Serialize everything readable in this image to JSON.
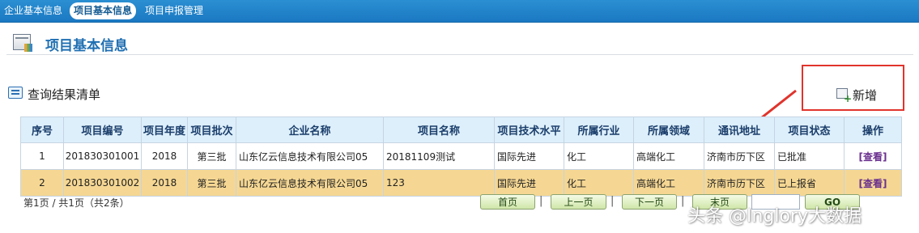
{
  "nav": {
    "tabs": [
      {
        "label": "企业基本信息",
        "active": false
      },
      {
        "label": "项目基本信息",
        "active": true
      },
      {
        "label": "项目申报管理",
        "active": false
      }
    ]
  },
  "page": {
    "title": "项目基本信息"
  },
  "results": {
    "title": "查询结果清单",
    "add_label": "新增"
  },
  "table": {
    "headers": [
      "序号",
      "项目编号",
      "项目年度",
      "项目批次",
      "企业名称",
      "项目名称",
      "项目技术水平",
      "所属行业",
      "所属领域",
      "通讯地址",
      "项目状态",
      "操作"
    ],
    "rows": [
      [
        "1",
        "201830301001",
        "2018",
        "第三批",
        "山东亿云信息技术有限公司05",
        "20181109测试",
        "国际先进",
        "化工",
        "高端化工",
        "济南市历下区",
        "已批准",
        "[查看]"
      ],
      [
        "2",
        "201830301002",
        "2018",
        "第三批",
        "山东亿云信息技术有限公司05",
        "123",
        "国际先进",
        "化工",
        "高端化工",
        "济南市历下区",
        "已上报省",
        "[查看]"
      ]
    ]
  },
  "pager": {
    "info": "第1页 / 共1页（共2条）",
    "first": "首页",
    "prev": "上一页",
    "next": "下一页",
    "last": "末页",
    "go": "GO",
    "separator": "|"
  },
  "watermark": "头条 @Inglory大数据",
  "colors": {
    "nav_bg": "#1a78c2",
    "header_bg": "#ddeffb",
    "highlight_row": "#f5d793",
    "callout_red": "#e0342c",
    "link_purple": "#6a2f8f"
  },
  "icons": [
    "page-icon",
    "list-icon",
    "add-icon",
    "arrow-icon"
  ]
}
